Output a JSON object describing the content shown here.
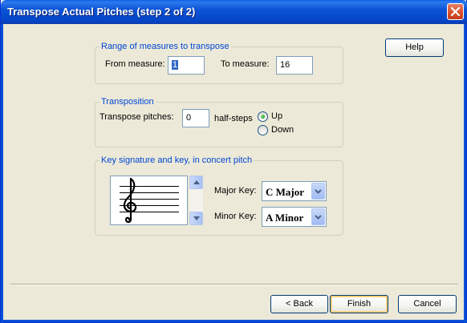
{
  "window": {
    "title": "Transpose Actual Pitches (step 2 of 2)"
  },
  "buttons": {
    "help": "Help",
    "back": "< Back",
    "finish": "Finish",
    "cancel": "Cancel"
  },
  "range_group": {
    "legend": "Range of measures to transpose",
    "from_label": "From measure:",
    "from_value": "1",
    "to_label": "To measure:",
    "to_value": "16"
  },
  "transposition_group": {
    "legend": "Transposition",
    "pitches_label": "Transpose pitches:",
    "pitches_value": "0",
    "unit_label": "half-steps",
    "direction_options": [
      "Up",
      "Down"
    ],
    "direction_selected": "Up"
  },
  "key_group": {
    "legend": "Key signature and key, in concert pitch",
    "clef": "treble",
    "major_label": "Major Key:",
    "major_value": "C Major",
    "minor_label": "Minor Key:",
    "minor_value": "A Minor"
  },
  "colors": {
    "title_bar": "#0a54d6",
    "legend_text": "#0046d5",
    "selection": "#316ac5"
  },
  "icons": {
    "close": "close-icon",
    "scroll_up": "arrow-up-icon",
    "scroll_down": "arrow-down-icon",
    "dropdown": "chevron-down-icon",
    "clef": "treble-clef-icon"
  }
}
